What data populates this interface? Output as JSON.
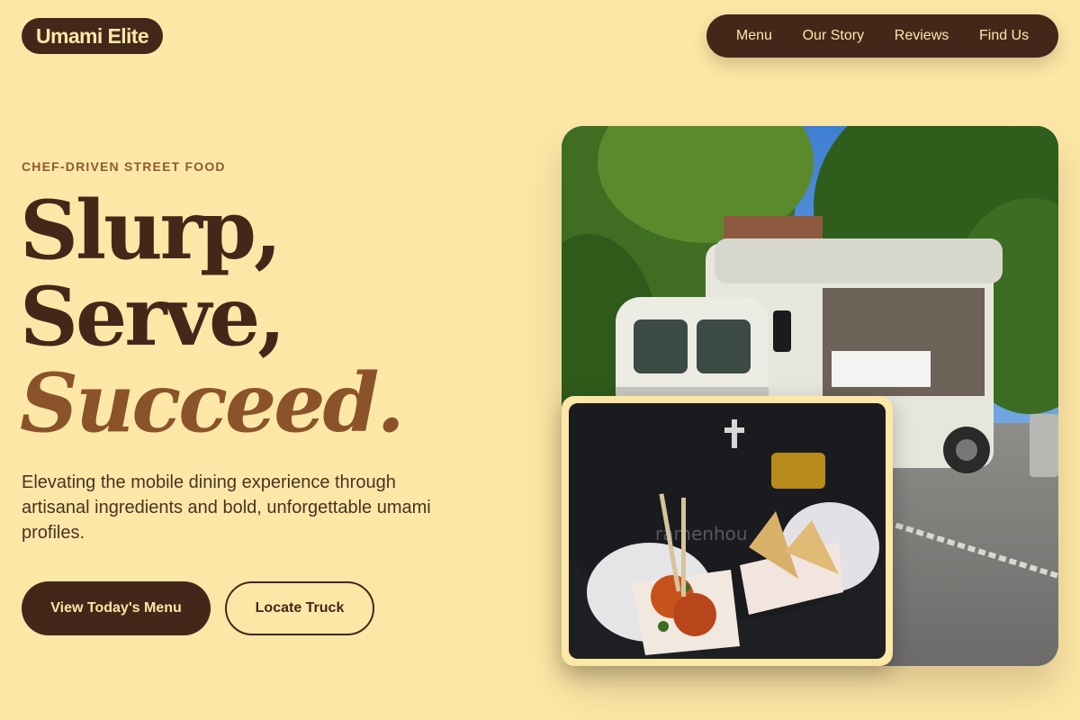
{
  "brand": {
    "name": "Umami Elite"
  },
  "nav": {
    "items": [
      {
        "label": "Menu"
      },
      {
        "label": "Our Story"
      },
      {
        "label": "Reviews"
      },
      {
        "label": "Find Us"
      }
    ]
  },
  "hero": {
    "eyebrow": "CHEF-DRIVEN STREET FOOD",
    "headline": {
      "line1": "Slurp,",
      "line2": "Serve,",
      "line3": "Succeed."
    },
    "subtext": "Elevating the mobile dining experience through artisanal ingredients and bold, unforgettable umami profiles.",
    "primary_cta": "View Today's Menu",
    "secondary_cta": "Locate Truck"
  },
  "photos": {
    "main": {
      "subject": "food-truck-photo"
    },
    "inset": {
      "subject": "street-food-plates-photo",
      "watermark": "ramenhou"
    }
  },
  "colors": {
    "background": "#fde7a6",
    "dark": "#43281a",
    "accent": "#8b5329"
  }
}
